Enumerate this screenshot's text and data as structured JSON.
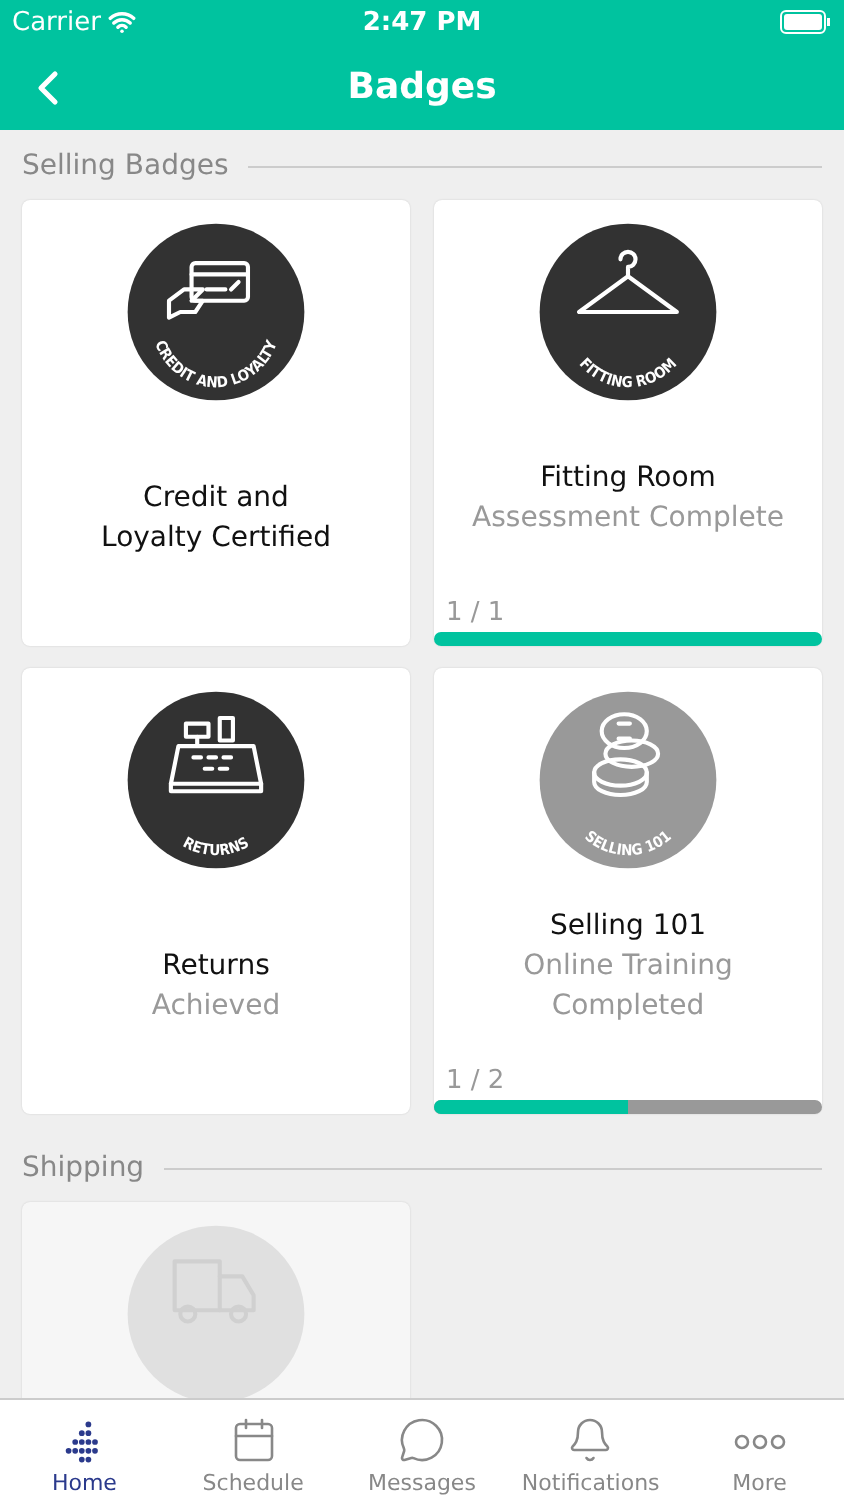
{
  "status_bar": {
    "carrier": "Carrier",
    "time": "2:47 PM"
  },
  "nav": {
    "title": "Badges"
  },
  "sections": [
    {
      "title": "Selling Badges",
      "badges": [
        {
          "kind": "card",
          "achieved": true,
          "locked": false,
          "emblem": "CREDIT AND LOYALTY",
          "title": "Credit and Loyalty Certified"
        },
        {
          "kind": "hanger",
          "achieved": true,
          "locked": false,
          "emblem": "FITTING ROOM",
          "title": "Fitting Room",
          "subtitle": [
            "Assessment Complete"
          ],
          "progress": {
            "label": "1 / 1",
            "level": 1
          }
        },
        {
          "kind": "register",
          "achieved": true,
          "locked": false,
          "emblem": "RETURNS",
          "title": "Returns",
          "subtitle": [
            "Achieved"
          ]
        },
        {
          "kind": "coins",
          "achieved": false,
          "locked": false,
          "emblem": "SELLING 101",
          "title": "Selling 101",
          "subtitle": [
            "Online Training",
            "Completed"
          ],
          "progress": {
            "label": "1 / 2",
            "level": 0.5
          }
        }
      ]
    },
    {
      "title": "Shipping",
      "badges": [
        {
          "kind": "truck",
          "locked": true
        }
      ]
    }
  ],
  "tabs": [
    {
      "kind": "home",
      "label": "Home",
      "selected": true
    },
    {
      "kind": "calendar",
      "label": "Schedule",
      "selected": false
    },
    {
      "kind": "message",
      "label": "Messages",
      "selected": false
    },
    {
      "kind": "bell",
      "label": "Notifications",
      "selected": false
    },
    {
      "kind": "more",
      "label": "More",
      "selected": false
    }
  ]
}
